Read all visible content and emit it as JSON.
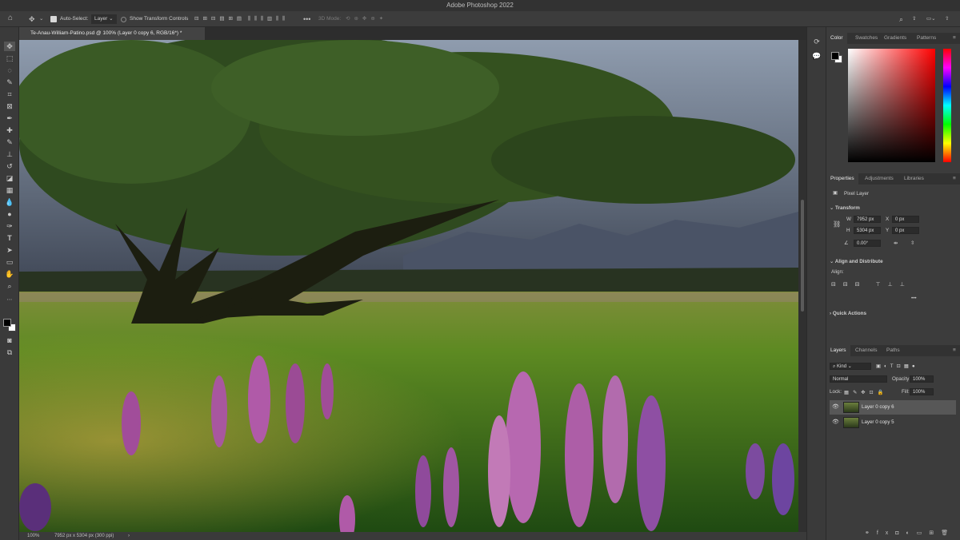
{
  "app": {
    "title": "Adobe Photoshop 2022"
  },
  "options": {
    "auto_select_label": "Auto-Select:",
    "auto_select_value": "Layer",
    "show_transform": "Show Transform Controls",
    "mode_3d": "3D Mode:"
  },
  "document": {
    "tab": "Te-Anau-William-Patino.psd @ 100% (Layer 0 copy 6, RGB/16*) *"
  },
  "status": {
    "zoom": "100%",
    "info": "7952 px x 5304 px (300 ppi)"
  },
  "panels": {
    "color_tabs": [
      "Color",
      "Swatches",
      "Gradients",
      "Patterns"
    ],
    "prop_tabs": [
      "Properties",
      "Adjustments",
      "Libraries"
    ],
    "layer_tabs": [
      "Layers",
      "Channels",
      "Paths"
    ]
  },
  "properties": {
    "type": "Pixel Layer",
    "transform_title": "Transform",
    "w_label": "W",
    "w": "7952 px",
    "x_label": "X",
    "x": "0 px",
    "h_label": "H",
    "h": "5304 px",
    "y_label": "Y",
    "y": "0 px",
    "angle": "0.00°",
    "align_title": "Align and Distribute",
    "align_label": "Align:",
    "quick_title": "Quick Actions"
  },
  "layers_panel": {
    "filter": "Kind",
    "blend": "Normal",
    "opacity_label": "Opacity:",
    "opacity": "100%",
    "lock_label": "Lock:",
    "fill_label": "Fill:",
    "fill": "100%",
    "layers": [
      {
        "name": "Layer 0 copy 6"
      },
      {
        "name": "Layer 0 copy 5"
      }
    ]
  },
  "colors": {
    "accent": "#1473e6",
    "fg": "#000000",
    "bg": "#ffffff"
  }
}
